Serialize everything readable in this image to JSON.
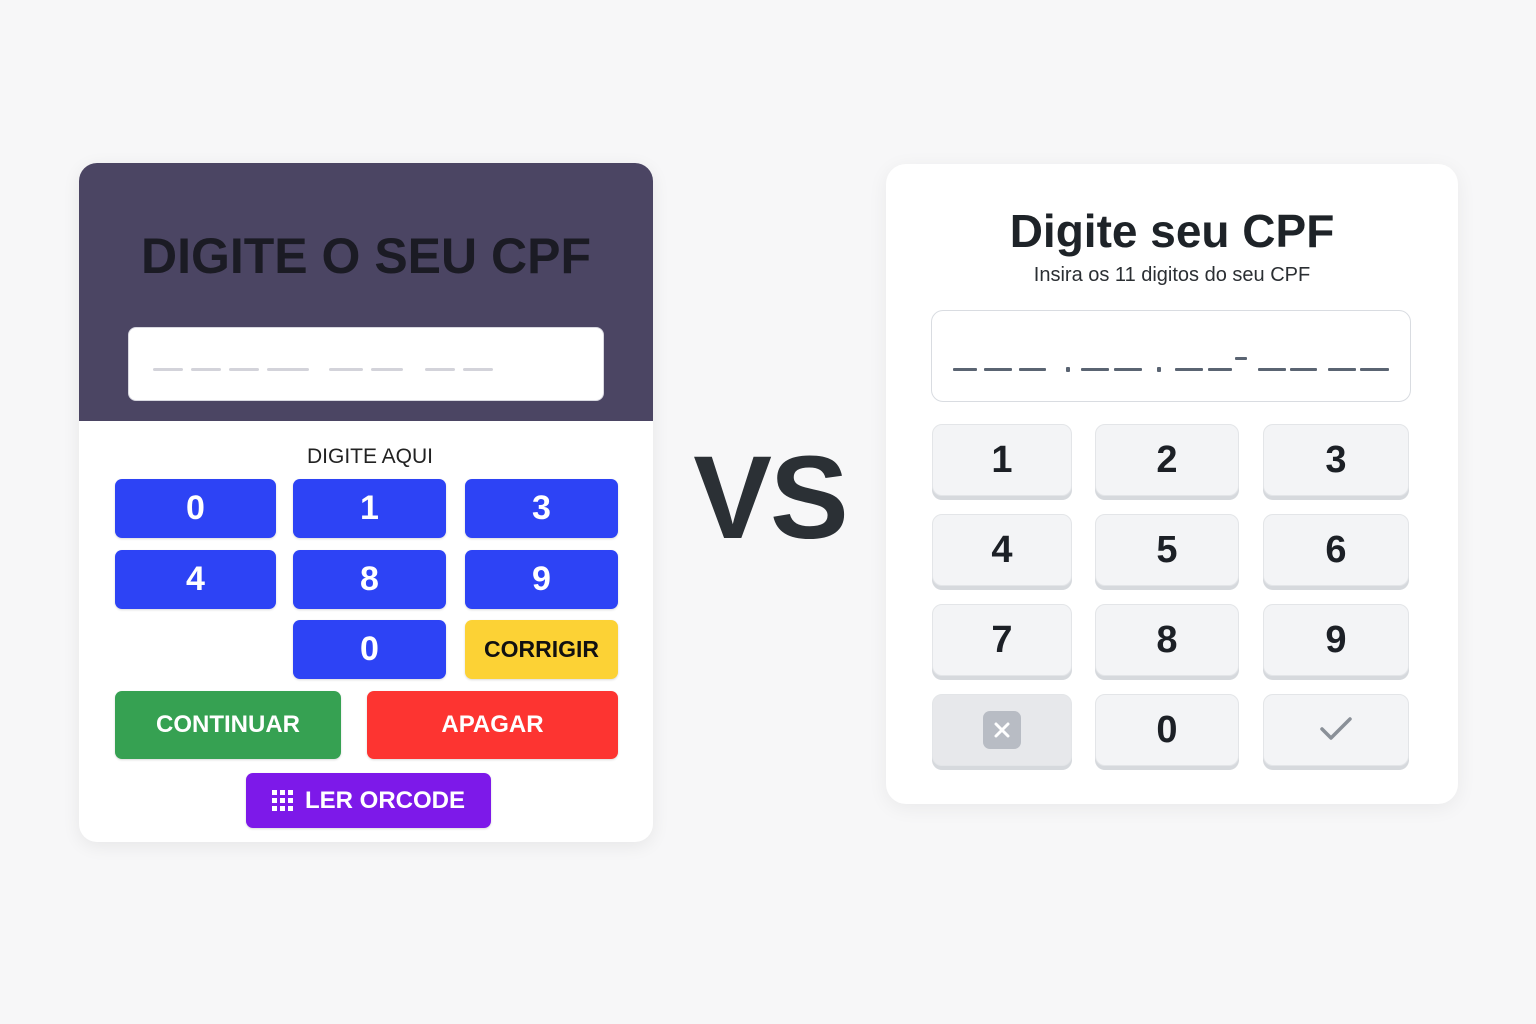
{
  "left": {
    "title": "DIGITE O SEU CPF",
    "caption": "DIGITE AQUI",
    "keys": [
      "0",
      "1",
      "3",
      "4",
      "8",
      "9",
      "0"
    ],
    "corrigir": "CORRIGIR",
    "continuar": "CONTINUAR",
    "apagar": "APAGAR",
    "qrcode": "LER ORCODE",
    "colors": {
      "header": "#4b4563",
      "digit": "#2d43f5",
      "corrigir": "#fcd235",
      "continuar": "#36a152",
      "apagar": "#fd3431",
      "qrcode": "#7d19e9"
    }
  },
  "vs": "VS",
  "right": {
    "title": "Digite seu CPF",
    "subtitle": "Insira os 11 digitos do seu CPF",
    "keys": [
      "1",
      "2",
      "3",
      "4",
      "5",
      "6",
      "7",
      "8",
      "9"
    ],
    "zero": "0",
    "delete_icon": "close-icon",
    "confirm_icon": "checkmark-icon"
  }
}
